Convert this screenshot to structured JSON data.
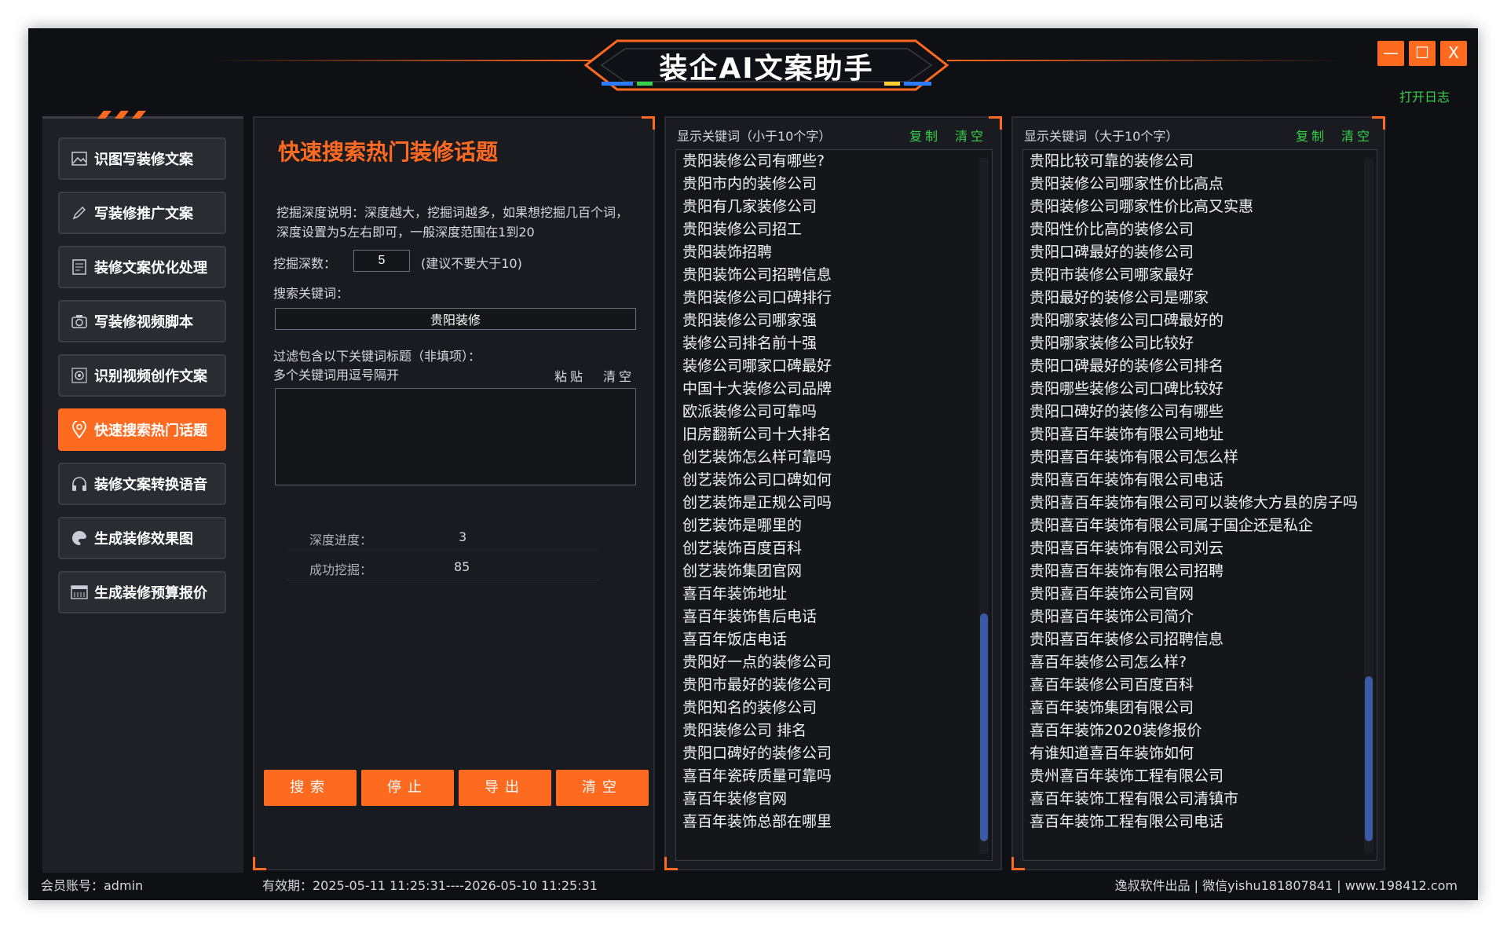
{
  "app": {
    "title": "装企AI文案助手",
    "open_log": "打开日志",
    "win_buttons": [
      "—",
      "☐",
      "X"
    ]
  },
  "sidebar": {
    "items": [
      {
        "label": "识图写装修文案",
        "icon": "image-icon"
      },
      {
        "label": "写装修推广文案",
        "icon": "pen-icon"
      },
      {
        "label": "装修文案优化处理",
        "icon": "document-icon"
      },
      {
        "label": "写装修视频脚本",
        "icon": "camera-icon"
      },
      {
        "label": "识别视频创作文案",
        "icon": "gear-icon"
      },
      {
        "label": "快速搜索热门话题",
        "icon": "location-pin-icon",
        "active": true
      },
      {
        "label": "装修文案转换语音",
        "icon": "headphones-icon"
      },
      {
        "label": "生成装修效果图",
        "icon": "palette-icon"
      },
      {
        "label": "生成装修预算报价",
        "icon": "calculator-icon"
      }
    ]
  },
  "search": {
    "title": "快速搜索热门装修话题",
    "depth_note": "挖掘深度说明：深度越大，挖掘词越多，如果想挖掘几百个词，深度设置为5左右即可，一般深度范围在1到20",
    "depth_label": "挖掘深数：",
    "depth_value": "5",
    "depth_hint": "(建议不要大于10)",
    "keyword_label": "搜索关键词：",
    "keyword_value": "贵阳装修",
    "filter_label": "过滤包含以下关键词标题（非填项）：",
    "filter_hint": "多个关键词用逗号隔开",
    "paste": "粘贴",
    "clear": "清空",
    "progress_label": "深度进度：",
    "progress_value": "3",
    "success_label": "成功挖掘：",
    "success_value": "85",
    "buttons": {
      "search": "搜索",
      "stop": "停止",
      "export": "导出",
      "clear": "清空"
    }
  },
  "short_list": {
    "header": "显示关键词（小于10个字）",
    "copy": "复制",
    "clear": "清空",
    "items": [
      "贵阳装修公司有哪些?",
      "贵阳市内的装修公司",
      "贵阳有几家装修公司",
      "贵阳装修公司招工",
      "贵阳装饰招聘",
      "贵阳装饰公司招聘信息",
      "贵阳装修公司口碑排行",
      "贵阳装修公司哪家强",
      "装修公司排名前十强",
      "装修公司哪家口碑最好",
      "中国十大装修公司品牌",
      "欧派装修公司可靠吗",
      "旧房翻新公司十大排名",
      "创艺装饰怎么样可靠吗",
      "创艺装饰公司口碑如何",
      "创艺装饰是正规公司吗",
      "创艺装饰是哪里的",
      "创艺装饰百度百科",
      "创艺装饰集团官网",
      "喜百年装饰地址",
      "喜百年装饰售后电话",
      "喜百年饭店电话",
      "贵阳好一点的装修公司",
      "贵阳市最好的装修公司",
      "贵阳知名的装修公司",
      "贵阳装修公司 排名",
      "贵阳口碑好的装修公司",
      "喜百年瓷砖质量可靠吗",
      "喜百年装修官网",
      "喜百年装饰总部在哪里"
    ]
  },
  "long_list": {
    "header": "显示关键词（大于10个字）",
    "copy": "复制",
    "clear": "清空",
    "items": [
      "贵阳比较可靠的装修公司",
      "贵阳装修公司哪家性价比高点",
      "贵阳装修公司哪家性价比高又实惠",
      "贵阳性价比高的装修公司",
      "贵阳口碑最好的装修公司",
      "贵阳市装修公司哪家最好",
      "贵阳最好的装修公司是哪家",
      "贵阳哪家装修公司口碑最好的",
      "贵阳哪家装修公司比较好",
      "贵阳口碑最好的装修公司排名",
      "贵阳哪些装修公司口碑比较好",
      "贵阳口碑好的装修公司有哪些",
      "贵阳喜百年装饰有限公司地址",
      "贵阳喜百年装饰有限公司怎么样",
      "贵阳喜百年装饰有限公司电话",
      "贵阳喜百年装饰有限公司可以装修大方县的房子吗",
      "贵阳喜百年装饰有限公司属于国企还是私企",
      "贵阳喜百年装饰有限公司刘云",
      "贵阳喜百年装饰有限公司招聘",
      "贵阳喜百年装饰公司官网",
      "贵阳喜百年装饰公司简介",
      "贵阳喜百年装修公司招聘信息",
      "喜百年装修公司怎么样?",
      "喜百年装修公司百度百科",
      "喜百年装饰集团有限公司",
      "喜百年装饰2020装修报价",
      "有谁知道喜百年装饰如何",
      "贵州喜百年装饰工程有限公司",
      "喜百年装饰工程有限公司清镇市",
      "喜百年装饰工程有限公司电话"
    ]
  },
  "footer": {
    "account": "会员账号：admin",
    "validity": "有效期：2025-05-11 11:25:31----2026-05-10 11:25:31",
    "credits": "逸叔软件出品 | 微信yishu181807841 | www.198412.com"
  }
}
